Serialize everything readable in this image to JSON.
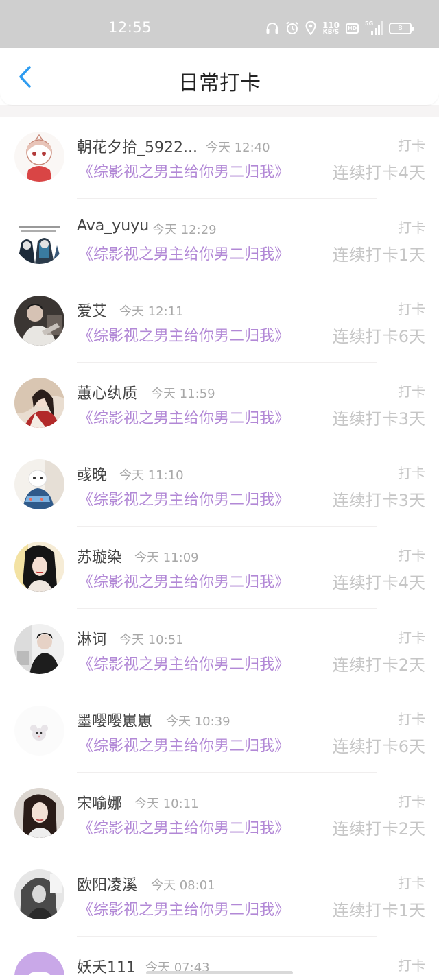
{
  "status_bar": {
    "time": "12:55",
    "net_speed_value": "110",
    "net_speed_unit": "KB/S",
    "hd_label": "HD",
    "signal_label": "5G",
    "battery_level": "8",
    "icons": [
      "headphones-icon",
      "alarm-icon",
      "location-icon",
      "hd-icon",
      "signal-5g-icon",
      "battery-icon"
    ]
  },
  "nav": {
    "title": "日常打卡",
    "back_icon": "chevron-left-icon",
    "accent_color": "#2f9cf0"
  },
  "colors": {
    "book_title": "#b288d6",
    "muted": "#c6c6c6",
    "time": "#a8a8a8"
  },
  "checkins": [
    {
      "name": "朝花夕拾_5922...",
      "time": "今天 12:40",
      "book": "《综影视之男主给你男二归我》",
      "tag": "打卡",
      "streak": "连续打卡4天"
    },
    {
      "name": "Ava_yuyu",
      "time": "今天 12:29",
      "book": "《综影视之男主给你男二归我》",
      "tag": "打卡",
      "streak": "连续打卡1天"
    },
    {
      "name": "爱艾",
      "time": "今天 12:11",
      "book": "《综影视之男主给你男二归我》",
      "tag": "打卡",
      "streak": "连续打卡6天"
    },
    {
      "name": "蕙心纨质",
      "time": "今天 11:59",
      "book": "《综影视之男主给你男二归我》",
      "tag": "打卡",
      "streak": "连续打卡3天"
    },
    {
      "name": "彧晚",
      "time": "今天 11:10",
      "book": "《综影视之男主给你男二归我》",
      "tag": "打卡",
      "streak": "连续打卡3天"
    },
    {
      "name": "苏璇染",
      "time": "今天 11:09",
      "book": "《综影视之男主给你男二归我》",
      "tag": "打卡",
      "streak": "连续打卡4天"
    },
    {
      "name": "淋诃",
      "time": "今天 10:51",
      "book": "《综影视之男主给你男二归我》",
      "tag": "打卡",
      "streak": "连续打卡2天"
    },
    {
      "name": "墨嘤嘤崽崽",
      "time": "今天 10:39",
      "book": "《综影视之男主给你男二归我》",
      "tag": "打卡",
      "streak": "连续打卡6天"
    },
    {
      "name": "宋喻娜",
      "time": "今天 10:11",
      "book": "《综影视之男主给你男二归我》",
      "tag": "打卡",
      "streak": "连续打卡2天"
    },
    {
      "name": "欧阳凌溪",
      "time": "今天 08:01",
      "book": "《综影视之男主给你男二归我》",
      "tag": "打卡",
      "streak": "连续打卡1天"
    },
    {
      "name": "妖夭111",
      "time": "今天 07:43",
      "book": "",
      "tag": "打卡",
      "streak": ""
    }
  ]
}
